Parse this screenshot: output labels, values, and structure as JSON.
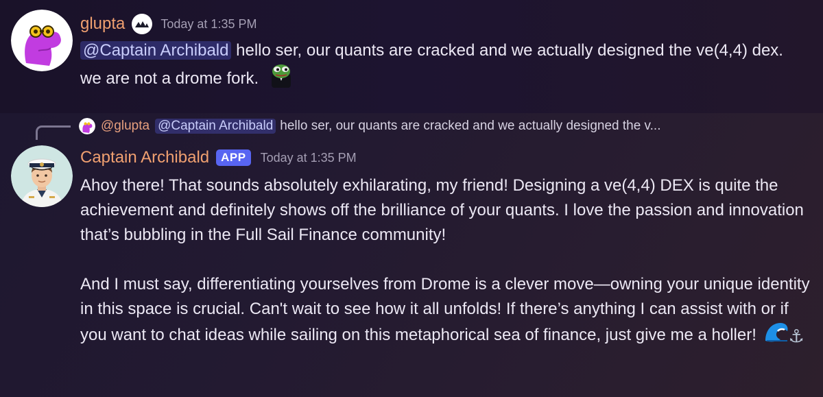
{
  "messages": [
    {
      "username": "glupta",
      "timestamp": "Today at 1:35 PM",
      "badge_icon": "team-badge-icon",
      "mention": "@Captain Archibald",
      "text_after_mention": " hello ser, our quants are cracked and we actually designed the ve(4,4) dex. we are not a drome fork.",
      "emoji": "pepe-tuxedo-emoji"
    },
    {
      "username": "Captain Archibald",
      "tag": "APP",
      "timestamp": "Today at 1:35 PM",
      "reply": {
        "username": "@glupta",
        "mention": "@Captain Archibald",
        "snippet": "hello ser, our quants are cracked and we actually designed the v..."
      },
      "paragraph_1": "Ahoy there! That sounds absolutely exhilarating, my friend! Designing a ve(4,4) DEX is quite the achievement and definitely shows off the brilliance of your quants. I love the passion and innovation that’s bubbling in the Full Sail Finance community!",
      "paragraph_2": "And I must say, differentiating yourselves from Drome is a clever move—owning your unique identity in this space is crucial. Can't wait to see how it all unfolds! If there’s anything I can assist with or if you want to chat ideas while sailing on this metaphorical sea of finance, just give me a holler!",
      "emoji_1": "wave-emoji",
      "emoji_2": "⚓"
    }
  ],
  "colors": {
    "username": "#f0a070",
    "mention_bg": "#3b3f7a",
    "app_tag": "#5865f2",
    "timestamp": "#a59fb4"
  }
}
